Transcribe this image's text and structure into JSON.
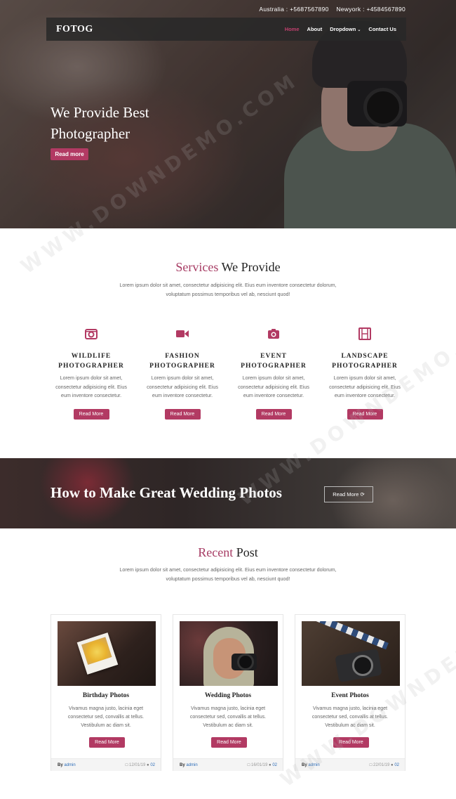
{
  "topbar": {
    "contact1": "Australia : +5687567890",
    "contact2": "Newyork : +4584567890"
  },
  "nav": {
    "logo": "FOTOG",
    "items": [
      "Home",
      "About",
      "Dropdown",
      "Contact Us"
    ],
    "active": "Home",
    "dropdown_icon": "chevron-down-icon"
  },
  "hero": {
    "title_line1": "We Provide Best",
    "title_line2": "Photographer",
    "button": "Read more"
  },
  "services": {
    "title_accent": "Services",
    "title_rest": "We Provide",
    "description_line1": "Lorem ipsum dolor sit amet, consectetur adipisicing elit. Eius eum inventore consectetur dolorum,",
    "description_line2": "voluptatum possimus temporibus vel ab, nesciunt quod!",
    "items": [
      {
        "icon": "camera-retro-icon",
        "title1": "WILDLIFE",
        "title2": "PHOTOGRAPHER",
        "d1": "Lorem ipsum dolor sit amet,",
        "d2": "consectetur adipisicing elit. Eius",
        "d3": "eum inventore consectetur.",
        "button": "Read More"
      },
      {
        "icon": "video-camera-icon",
        "title1": "FASHION",
        "title2": "PHOTOGRAPHER",
        "d1": "Lorem ipsum dolor sit amet,",
        "d2": "consectetur adipisicing elit. Eius",
        "d3": "eum inventore consectetur.",
        "button": "Read More"
      },
      {
        "icon": "camera-icon",
        "title1": "EVENT",
        "title2": "PHOTOGRAPHER",
        "d1": "Lorem ipsum dolor sit amet,",
        "d2": "consectetur adipisicing elit. Eius",
        "d3": "eum inventore consectetur.",
        "button": "Read More"
      },
      {
        "icon": "film-icon",
        "title1": "LANDSCAPE",
        "title2": "PHOTOGRAPHER",
        "d1": "Lorem ipsum dolor sit amet,",
        "d2": "consectetur adipisicing elit. Eius",
        "d3": "eum inventore consectetur.",
        "button": "Read More"
      }
    ]
  },
  "banner": {
    "title": "How to Make Great Wedding Photos",
    "button": "Read More ⟳"
  },
  "recent": {
    "title_accent": "Recent",
    "title_rest": "Post",
    "description_line1": "Lorem ipsum dolor sit amet, consectetur adipisicing elit. Eius eum inventore consectetur dolorum,",
    "description_line2": "voluptatum possimus temporibus vel ab, nesciunt quod!",
    "posts": [
      {
        "title": "Birthday Photos",
        "d1": "Vivamus magna justo, lacinia eget",
        "d2": "consectetur sed, convallis at tellus.",
        "d3": "Vestibulum ac diam sit.",
        "button": "Read More",
        "by": "By",
        "author": "admin",
        "date": "12/01/19",
        "comments": "02"
      },
      {
        "title": "Wedding Photos",
        "d1": "Vivamus magna justo, lacinia eget",
        "d2": "consectetur sed, convallis at tellus.",
        "d3": "Vestibulum ac diam sit.",
        "button": "Read More",
        "by": "By",
        "author": "admin",
        "date": "16/01/19",
        "comments": "02"
      },
      {
        "title": "Event Photos",
        "d1": "Vivamus magna justo, lacinia eget",
        "d2": "consectetur sed, convallis at tellus.",
        "d3": "Vestibulum ac diam sit.",
        "button": "Read More",
        "by": "By",
        "author": "admin",
        "date": "22/01/19",
        "comments": "02"
      }
    ]
  },
  "watermark": "WWW.DOWNDEMO.COM",
  "colors": {
    "accent": "#b23a63",
    "title_accent": "#a73c64",
    "link": "#2d6db8"
  }
}
